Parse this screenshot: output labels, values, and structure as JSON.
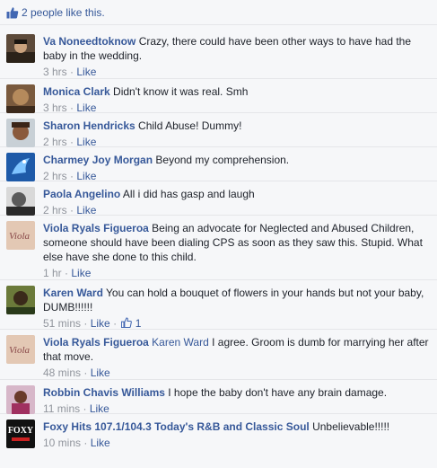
{
  "likes_bar": {
    "text": "2 people like this."
  },
  "like_label": "Like",
  "separator": "·",
  "comments": [
    {
      "author": "Va Noneedtoknow",
      "mention": "",
      "text": "Crazy, there could have been other ways to have had the baby in the wedding.",
      "time": "3 hrs",
      "likes": ""
    },
    {
      "author": "Monica Clark",
      "mention": "",
      "text": "Didn't know it was real. Smh",
      "time": "3 hrs",
      "likes": ""
    },
    {
      "author": "Sharon Hendricks",
      "mention": "",
      "text": "Child Abuse! Dummy!",
      "time": "2 hrs",
      "likes": ""
    },
    {
      "author": "Charmey Joy Morgan",
      "mention": "",
      "text": "Beyond my comprehension.",
      "time": "2 hrs",
      "likes": ""
    },
    {
      "author": "Paola Angelino",
      "mention": "",
      "text": "All i did has gasp and laugh",
      "time": "2 hrs",
      "likes": ""
    },
    {
      "author": "Viola Ryals Figueroa",
      "mention": "",
      "text": "Being an advocate for Neglected and Abused Children, someone should have been dialing CPS as soon as they saw this. Stupid. What else have she done to this child.",
      "time": "1 hr",
      "likes": ""
    },
    {
      "author": "Karen Ward",
      "mention": "",
      "text": "You can hold a bouquet of flowers in your hands but not your baby, DUMB!!!!!!",
      "time": "51 mins",
      "likes": "1"
    },
    {
      "author": "Viola Ryals Figueroa",
      "mention": "Karen Ward",
      "text": "I agree. Groom is dumb for marrying her after that move.",
      "time": "48 mins",
      "likes": ""
    },
    {
      "author": "Robbin Chavis Williams",
      "mention": "",
      "text": "I hope the baby don't have any brain damage.",
      "time": "11 mins",
      "likes": ""
    },
    {
      "author": "Foxy Hits 107.1/104.3 Today's R&B and Classic Soul",
      "mention": "",
      "text": "Unbelievable!!!!!",
      "time": "10 mins",
      "likes": ""
    }
  ],
  "avatars": {
    "foxy_logo_text": "FOXY",
    "viola_signature": "Viola"
  },
  "colors": {
    "link": "#365899",
    "text": "#1d2129",
    "meta": "#90949c",
    "background": "#f6f7f9"
  }
}
